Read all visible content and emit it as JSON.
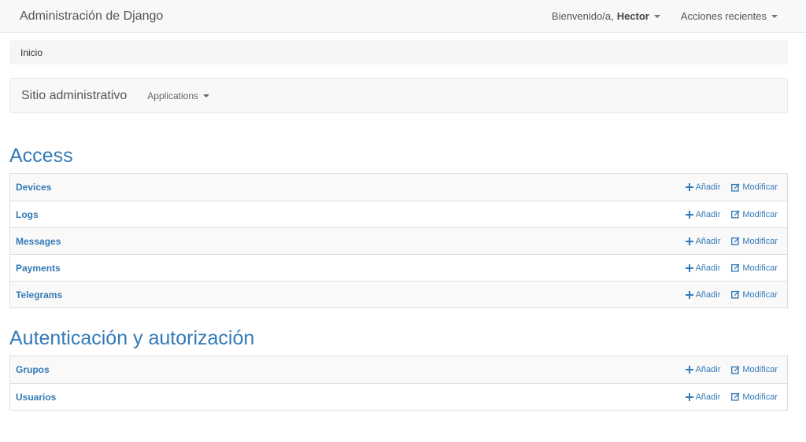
{
  "header": {
    "brand": "Administración de Django",
    "welcome_prefix": "Bienvenido/a,",
    "username": "Hector",
    "recent_actions": "Acciones recientes"
  },
  "breadcrumb": {
    "home": "Inicio"
  },
  "subnav": {
    "title": "Sitio administrativo",
    "apps_menu": "Applications"
  },
  "action_labels": {
    "add": "Añadir",
    "change": "Modificar"
  },
  "modules": [
    {
      "title": "Access",
      "models": [
        "Devices",
        "Logs",
        "Messages",
        "Payments",
        "Telegrams"
      ]
    },
    {
      "title": "Autenticación y autorización",
      "models": [
        "Grupos",
        "Usuarios"
      ]
    }
  ],
  "colors": {
    "link": "#337ab7",
    "navbar_bg": "#f8f8f8",
    "row_stripe": "#f9f9f9"
  },
  "icons": {
    "add": "plus-icon",
    "change": "edit-icon",
    "dropdown": "chevron-down-icon"
  }
}
